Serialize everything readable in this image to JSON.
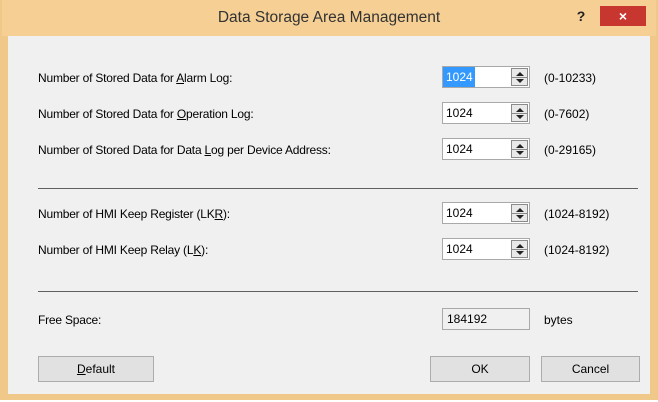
{
  "window": {
    "title": "Data Storage Area Management",
    "help_label": "?",
    "close_label": "×"
  },
  "rows": [
    {
      "prefix": "Number of Stored Data for ",
      "accel": "A",
      "suffix": "larm Log:",
      "value": "1024",
      "range": "(0-10233)"
    },
    {
      "prefix": "Number of Stored Data for ",
      "accel": "O",
      "suffix": "peration Log:",
      "value": "1024",
      "range": "(0-7602)"
    },
    {
      "prefix": "Number of Stored Data for Data ",
      "accel": "L",
      "suffix": "og per Device Address:",
      "value": "1024",
      "range": "(0-29165)"
    }
  ],
  "keep_rows": [
    {
      "prefix": "Number of HMI Keep Register (LK",
      "accel": "R",
      "suffix": "):",
      "value": "1024",
      "range": "(1024-8192)"
    },
    {
      "prefix": "Number of HMI Keep Relay (L",
      "accel": "K",
      "suffix": "):",
      "value": "1024",
      "range": "(1024-8192)"
    }
  ],
  "free_space": {
    "label": "Free Space:",
    "value": "184192",
    "unit": "bytes"
  },
  "buttons": {
    "default_accel": "D",
    "default_rest": "efault",
    "ok": "OK",
    "cancel": "Cancel"
  }
}
